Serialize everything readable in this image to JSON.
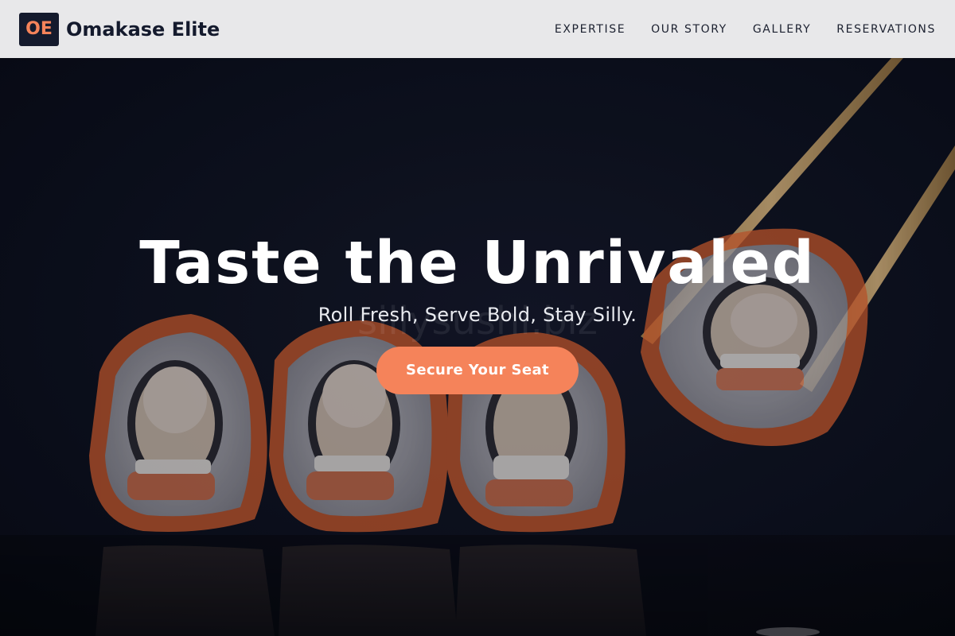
{
  "header": {
    "logo_initials": "OE",
    "brand_name": "Omakase Elite",
    "nav": [
      {
        "label": "EXPERTISE"
      },
      {
        "label": "OUR STORY"
      },
      {
        "label": "GALLERY"
      },
      {
        "label": "RESERVATIONS"
      }
    ]
  },
  "hero": {
    "title": "Taste the Unrivaled",
    "tagline": "Roll Fresh, Serve Bold, Stay Silly.",
    "cta_label": "Secure Your Seat",
    "watermark": "sillysushi.biz"
  },
  "colors": {
    "accent": "#f5835a",
    "header_bg": "#e8e8ea",
    "brand_dark": "#141a2d",
    "hero_bg": "#0a0d18"
  }
}
